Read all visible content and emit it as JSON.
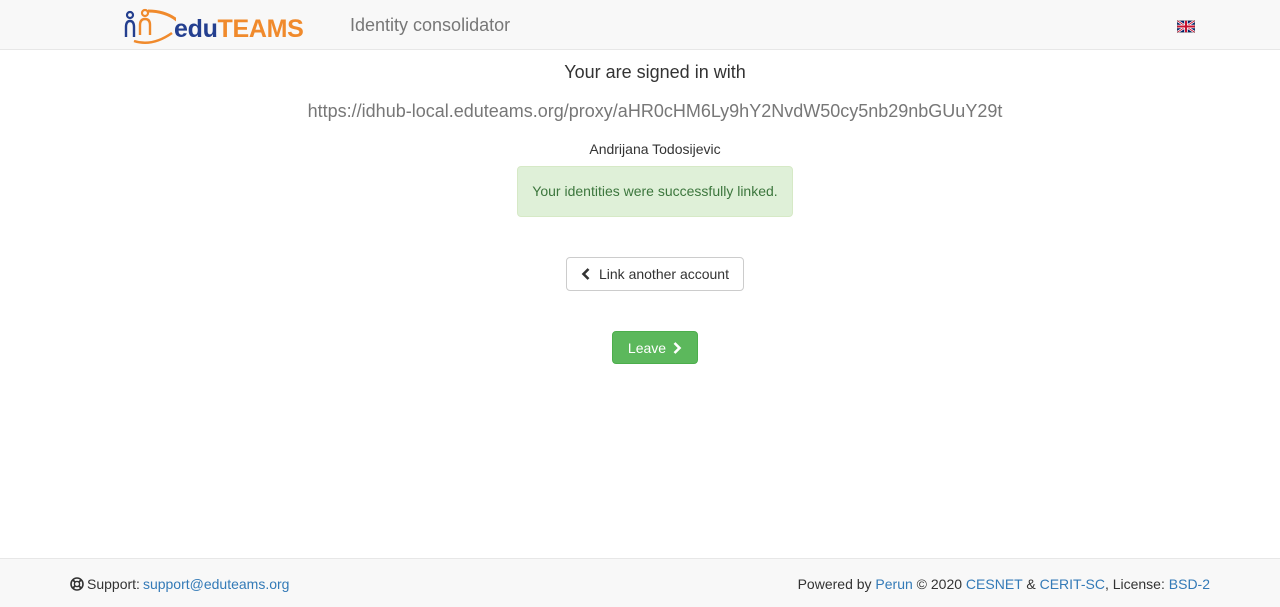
{
  "header": {
    "logo_edu": "edu",
    "logo_teams": "TEAMS",
    "title": "Identity consolidator",
    "language_icon": "uk-flag-icon"
  },
  "main": {
    "signed_in_text": "Your are signed in with",
    "proxy_url": "https://idhub-local.eduteams.org/proxy/aHR0cHM6Ly9hY2NvdW50cy5nb29nbGUuY29t",
    "user_name": "Andrijana Todosijevic",
    "alert_text": "Your identities were successfully linked.",
    "link_button_label": "Link another account",
    "leave_button_label": "Leave"
  },
  "footer": {
    "support_label": "Support:",
    "support_email": "support@eduteams.org",
    "powered_by": "Powered by",
    "perun": "Perun",
    "copyright": "© 2020",
    "cesnet": "CESNET",
    "amp": "&",
    "cerit": "CERIT-SC",
    "license_label": ", License:",
    "license": "BSD-2"
  },
  "colors": {
    "logo_blue": "#243f8f",
    "logo_orange": "#f08a2c",
    "success_bg": "#dff0d8",
    "success_text": "#3c763d",
    "btn_success": "#5cb85c",
    "link": "#337ab7"
  }
}
